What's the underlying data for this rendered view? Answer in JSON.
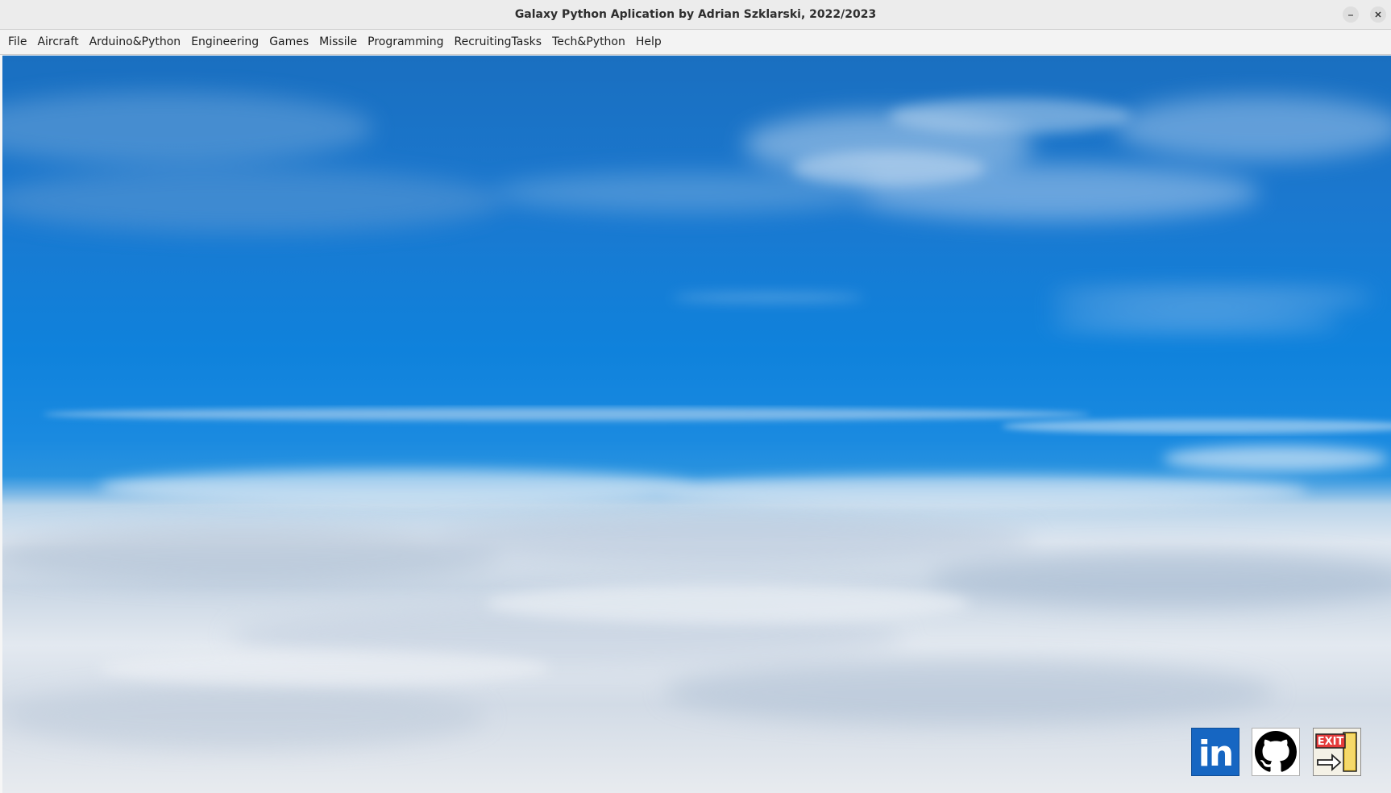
{
  "window": {
    "title": "Galaxy Python Aplication by Adrian Szklarski, 2022/2023",
    "controls": {
      "minimize": "–",
      "close": "✕"
    }
  },
  "menubar": {
    "items": [
      {
        "label": "File"
      },
      {
        "label": "Aircraft"
      },
      {
        "label": "Arduino&Python"
      },
      {
        "label": "Engineering"
      },
      {
        "label": "Games"
      },
      {
        "label": "Missile"
      },
      {
        "label": "Programming"
      },
      {
        "label": "RecruitingTasks"
      },
      {
        "label": "Tech&Python"
      },
      {
        "label": "Help"
      }
    ]
  },
  "background": {
    "description_icon": "sky-clouds-image",
    "colors": {
      "sky_top": "#1a6fc0",
      "sky_mid": "#0f82dc",
      "clouds": "#e3e9f0"
    }
  },
  "social_buttons": {
    "linkedin": {
      "icon": "linkedin-icon",
      "text": "in",
      "color": "#1666c2"
    },
    "github": {
      "icon": "github-icon",
      "color": "#000000"
    },
    "exit": {
      "icon": "exit-icon",
      "text": "EXIT",
      "color": "#e53b3b"
    }
  }
}
